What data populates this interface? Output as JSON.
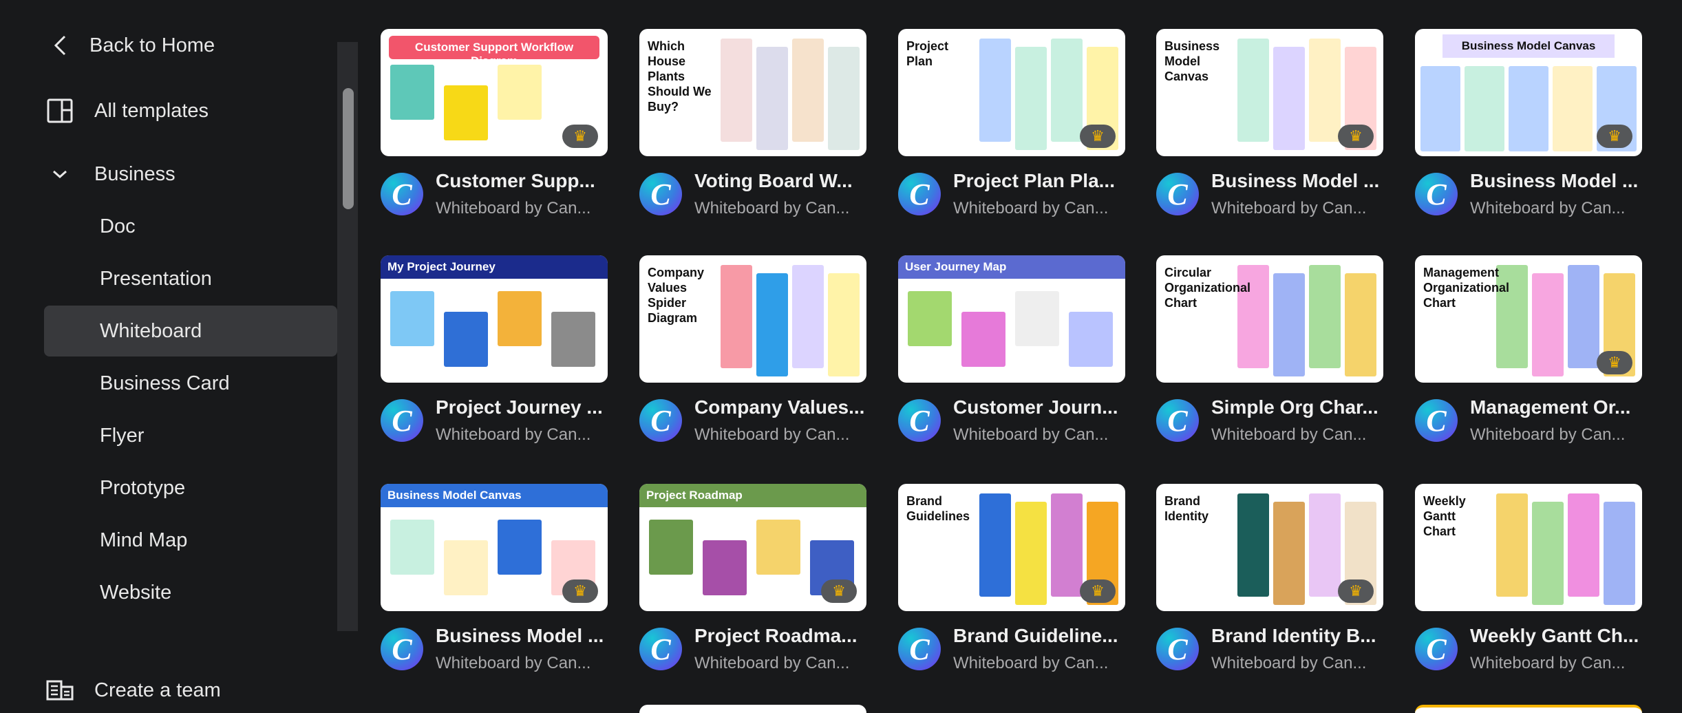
{
  "sidebar": {
    "back": "Back to Home",
    "all_templates": "All templates",
    "category": "Business",
    "items": [
      "Doc",
      "Presentation",
      "Whiteboard",
      "Business Card",
      "Flyer",
      "Prototype",
      "Mind Map",
      "Website"
    ],
    "active": "Whiteboard",
    "create_team": "Create a team"
  },
  "templates": [
    {
      "title": "Customer Supp...",
      "subtitle": "Whiteboard by Can...",
      "heading": "Customer Support Workflow Diagram",
      "style": "banner",
      "color": "#f2556b",
      "accents": [
        "#5ec8b8",
        "#f7d917",
        "#fff3a8"
      ],
      "premium": true
    },
    {
      "title": "Voting Board W...",
      "subtitle": "Whiteboard by Can...",
      "heading": "Which House Plants Should We Buy?",
      "style": "side",
      "color": "#ffffff",
      "accents": [
        "#f4dede",
        "#dcdcec",
        "#f6e2cc",
        "#dde9e6"
      ],
      "premium": false
    },
    {
      "title": "Project Plan Pla...",
      "subtitle": "Whiteboard by Can...",
      "heading": "Project Plan",
      "style": "side",
      "color": "#ffffff",
      "accents": [
        "#b9d3ff",
        "#c8f0e0",
        "#c8f0e0",
        "#fff3a8"
      ],
      "premium": true
    },
    {
      "title": "Business Model ...",
      "subtitle": "Whiteboard by Can...",
      "heading": "Business Model Canvas",
      "style": "side",
      "color": "#ffffff",
      "accents": [
        "#c8f0e0",
        "#dcd4ff",
        "#fff1c4",
        "#ffd4d4"
      ],
      "premium": true
    },
    {
      "title": "Business Model ...",
      "subtitle": "Whiteboard by Can...",
      "heading": "Business Model Canvas",
      "style": "pill",
      "color": "#e3dcff",
      "accents": [
        "#b9d3ff",
        "#c8f0e0",
        "#b9d3ff",
        "#fff1c4",
        "#b9d3ff"
      ],
      "premium": true
    },
    {
      "title": "Project Journey ...",
      "subtitle": "Whiteboard by Can...",
      "heading": "My Project Journey",
      "style": "banner",
      "color": "#1b2b8c",
      "accents": [
        "#7ec8f5",
        "#2f6fd6",
        "#f3b23a",
        "#8b8b8b"
      ],
      "premium": false
    },
    {
      "title": "Company Values...",
      "subtitle": "Whiteboard by Can...",
      "heading": "Company Values Spider Diagram",
      "style": "side",
      "color": "#ffffff",
      "accents": [
        "#f79aa6",
        "#2f9ee8",
        "#dcd4ff",
        "#fff3a8"
      ],
      "premium": false
    },
    {
      "title": "Customer Journ...",
      "subtitle": "Whiteboard by Can...",
      "heading": "User Journey Map",
      "style": "banner",
      "color": "#5b6ad0",
      "accents": [
        "#a3d86f",
        "#e67ad9",
        "#eeeeee",
        "#b9c3ff"
      ],
      "premium": false
    },
    {
      "title": "Simple Org Char...",
      "subtitle": "Whiteboard by Can...",
      "heading": "Circular Organizational Chart",
      "style": "side",
      "color": "#ffffff",
      "accents": [
        "#f7a6e0",
        "#9fb3f5",
        "#a8dd9c",
        "#f5d36b"
      ],
      "premium": false
    },
    {
      "title": "Management Or...",
      "subtitle": "Whiteboard by Can...",
      "heading": "Management Organizational Chart",
      "style": "side",
      "color": "#ffffff",
      "accents": [
        "#a8dd9c",
        "#f7a6e0",
        "#9fb3f5",
        "#f5d36b"
      ],
      "premium": true
    },
    {
      "title": "Business Model ...",
      "subtitle": "Whiteboard by Can...",
      "heading": "Business Model Canvas",
      "style": "banner",
      "color": "#2e6fd8",
      "accents": [
        "#c8f0e0",
        "#fff1c4",
        "#2e6fd8",
        "#ffd4d4"
      ],
      "premium": true
    },
    {
      "title": "Project Roadma...",
      "subtitle": "Whiteboard by Can...",
      "heading": "Project Roadmap",
      "style": "banner",
      "color": "#6b9a4c",
      "accents": [
        "#6b9a4c",
        "#a64fa8",
        "#f5d36b",
        "#3e5fc4"
      ],
      "premium": true
    },
    {
      "title": "Brand Guideline...",
      "subtitle": "Whiteboard by Can...",
      "heading": "Brand Guidelines",
      "style": "side",
      "color": "#ffffff",
      "accents": [
        "#2e6fd8",
        "#f5e142",
        "#d27fd1",
        "#f5a623"
      ],
      "premium": true
    },
    {
      "title": "Brand Identity B...",
      "subtitle": "Whiteboard by Can...",
      "heading": "Brand Identity",
      "style": "side",
      "color": "#ffffff",
      "accents": [
        "#1b5e5a",
        "#d9a35a",
        "#e9c6f5",
        "#f1e1c8"
      ],
      "premium": true
    },
    {
      "title": "Weekly Gantt Ch...",
      "subtitle": "Whiteboard by Can...",
      "heading": "Weekly Gantt Chart",
      "style": "side",
      "color": "#ffffff",
      "accents": [
        "#f5d36b",
        "#a8dd9c",
        "#f08fe0",
        "#9fb3f5"
      ],
      "premium": false
    }
  ]
}
